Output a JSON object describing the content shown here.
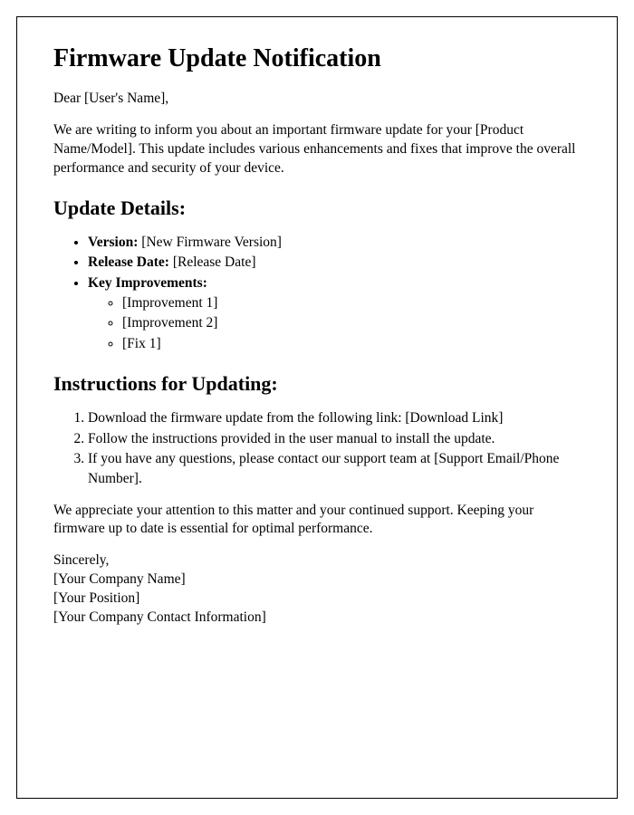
{
  "title": "Firmware Update Notification",
  "greeting": "Dear [User's Name],",
  "intro": "We are writing to inform you about an important firmware update for your [Product Name/Model]. This update includes various enhancements and fixes that improve the overall performance and security of your device.",
  "details_heading": "Update Details:",
  "details": {
    "version_label": "Version:",
    "version_value": " [New Firmware Version]",
    "release_label": "Release Date:",
    "release_value": " [Release Date]",
    "improvements_label": "Key Improvements:",
    "improvements": {
      "item1": "[Improvement 1]",
      "item2": "[Improvement 2]",
      "item3": "[Fix 1]"
    }
  },
  "instructions_heading": "Instructions for Updating:",
  "instructions": {
    "step1": "Download the firmware update from the following link: [Download Link]",
    "step2": "Follow the instructions provided in the user manual to install the update.",
    "step3": "If you have any questions, please contact our support team at [Support Email/Phone Number]."
  },
  "closing": "We appreciate your attention to this matter and your continued support. Keeping your firmware up to date is essential for optimal performance.",
  "signature": {
    "sincerely": "Sincerely,",
    "company": "[Your Company Name]",
    "position": "[Your Position]",
    "contact": "[Your Company Contact Information]"
  }
}
